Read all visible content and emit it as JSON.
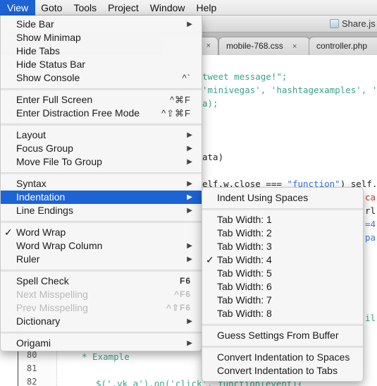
{
  "menubar": {
    "items": [
      {
        "label": "View",
        "active": true
      },
      {
        "label": "Goto"
      },
      {
        "label": "Tools"
      },
      {
        "label": "Project"
      },
      {
        "label": "Window"
      },
      {
        "label": "Help"
      }
    ]
  },
  "window": {
    "title": "Share.js",
    "tabs": [
      {
        "label": "",
        "close": "×"
      },
      {
        "label": "mobile-768.css",
        "close": "×"
      },
      {
        "label": "controller.php",
        "close": ""
      }
    ]
  },
  "code": {
    "fragments": [
      "tweet message!\";",
      "'minivegas', 'hashtagexamples', 'wee",
      "a);",
      "ata)",
      "elf.w.close === ",
      "\"function\"",
      ") self.w.",
      "c",
      "ca",
      "rl",
      "=4",
      "pa",
      "il",
      "* Example",
      "$('.vk a').on('click', function(event){"
    ],
    "line_numbers": [
      "80",
      "81",
      "82"
    ]
  },
  "view_menu": {
    "items": [
      {
        "label": "Side Bar",
        "submenu": true
      },
      {
        "label": "Show Minimap"
      },
      {
        "label": "Hide Tabs"
      },
      {
        "label": "Hide Status Bar"
      },
      {
        "label": "Show Console",
        "shortcut": "^`"
      },
      {
        "label": "Enter Full Screen",
        "shortcut": "^⌘F"
      },
      {
        "label": "Enter Distraction Free Mode",
        "shortcut": "^⇧⌘F"
      },
      {
        "label": "Layout",
        "submenu": true
      },
      {
        "label": "Focus Group",
        "submenu": true
      },
      {
        "label": "Move File To Group",
        "submenu": true
      },
      {
        "label": "Syntax",
        "submenu": true
      },
      {
        "label": "Indentation",
        "submenu": true,
        "highlighted": true
      },
      {
        "label": "Line Endings",
        "submenu": true
      },
      {
        "label": "Word Wrap",
        "checked": true
      },
      {
        "label": "Word Wrap Column",
        "submenu": true
      },
      {
        "label": "Ruler",
        "submenu": true
      },
      {
        "label": "Spell Check",
        "shortcut": "F6"
      },
      {
        "label": "Next Misspelling",
        "shortcut": "^F6",
        "disabled": true
      },
      {
        "label": "Prev Misspelling",
        "shortcut": "^⇧F6",
        "disabled": true
      },
      {
        "label": "Dictionary",
        "submenu": true
      },
      {
        "label": "Origami",
        "submenu": true
      }
    ]
  },
  "indentation_menu": {
    "items": [
      {
        "label": "Indent Using Spaces"
      },
      {
        "label": "Tab Width: 1"
      },
      {
        "label": "Tab Width: 2"
      },
      {
        "label": "Tab Width: 3"
      },
      {
        "label": "Tab Width: 4",
        "checked": true
      },
      {
        "label": "Tab Width: 5"
      },
      {
        "label": "Tab Width: 6"
      },
      {
        "label": "Tab Width: 7"
      },
      {
        "label": "Tab Width: 8"
      },
      {
        "label": "Guess Settings From Buffer"
      },
      {
        "label": "Convert Indentation to Spaces"
      },
      {
        "label": "Convert Indentation to Tabs"
      }
    ]
  },
  "glyphs": {
    "check": "✓",
    "submenu_arrow": "▶"
  }
}
